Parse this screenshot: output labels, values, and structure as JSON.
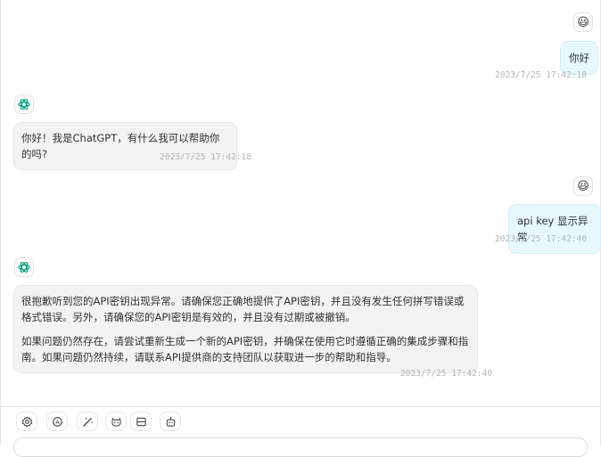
{
  "messages": [
    {
      "role": "user",
      "text": "你好",
      "time": "2023/7/25 17:42:18"
    },
    {
      "role": "assistant",
      "text": "你好！我是ChatGPT，有什么我可以帮助你的吗?",
      "time": "2023/7/25 17:42:18"
    },
    {
      "role": "user",
      "text": "api key 显示异常",
      "time": "2023/7/25 17:42:40"
    },
    {
      "role": "assistant",
      "paragraphs": [
        "很抱歉听到您的API密钥出现异常。请确保您正确地提供了API密钥，并且没有发生任何拼写错误或格式错误。另外，请确保您的API密钥是有效的，并且没有过期或被撤销。",
        "如果问题仍然存在，请尝试重新生成一个新的API密钥，并确保在使用它时遵循正确的集成步骤和指南。如果问题仍然持续，请联系API提供商的支持团队以获取进一步的帮助和指导。"
      ],
      "time": "2023/7/25 17:42:40"
    }
  ],
  "avatars": {
    "user": "😃",
    "assistant": "openai-logo-icon"
  },
  "colors": {
    "user_bubble": "#e7f8ff",
    "bot_bubble": "#f3f3f3",
    "timestamp": "#b4b4b4"
  },
  "toolbar": [
    {
      "icon": "settings-icon"
    },
    {
      "icon": "theme-auto-icon"
    },
    {
      "icon": "prompt-magic-icon"
    },
    {
      "icon": "mask-icon"
    },
    {
      "icon": "layout-icon"
    },
    {
      "icon": "bot-icon"
    }
  ]
}
